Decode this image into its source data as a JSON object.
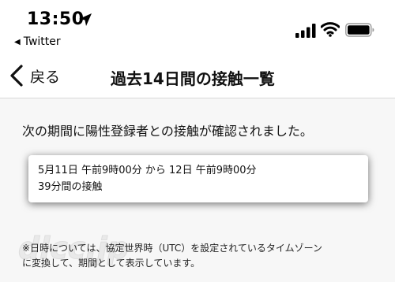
{
  "status_bar": {
    "time": "13:50",
    "back_app": "Twitter",
    "icons": [
      "location-arrow",
      "cellular-signal",
      "wifi",
      "battery"
    ]
  },
  "nav": {
    "back_label": "戻る",
    "title": "過去14日間の接触一覧"
  },
  "main": {
    "lead": "次の期間に陽性登録者との接触が確認されました。",
    "contact": {
      "period": "5月11日 午前9時00分 から 12日 午前9時00分",
      "duration": "39分間の接触"
    },
    "note_line1": "※日時については、協定世界時（UTC）を設定されているタイムゾーン",
    "note_line2": "に変換して、期間として表示しています。"
  },
  "watermark": "dlcc.jp"
}
